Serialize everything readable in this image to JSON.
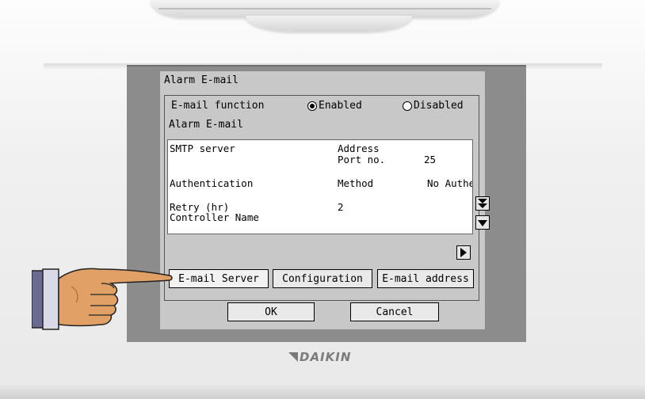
{
  "screen": {
    "title": "Alarm E-mail",
    "email_function": {
      "label": "E-mail function",
      "options": [
        "Enabled",
        "Disabled"
      ],
      "selected": "Enabled"
    },
    "section_label": "Alarm E-mail",
    "settings": {
      "smtp_server": "SMTP server",
      "address": "Address",
      "port_label": "Port no.",
      "port_value": "25",
      "authentication": "Authentication",
      "method_label": "Method",
      "method_value": "No Authe",
      "retry": "Retry (hr)",
      "retry_value": "2",
      "controller_name": "Controller Name"
    },
    "tabs": [
      "E-mail Server",
      "Configuration",
      "E-mail address"
    ],
    "active_tab": "E-mail Server",
    "ok": "OK",
    "cancel": "Cancel"
  },
  "brand": "DAIKIN",
  "icons": {
    "scroll_bottom": "double-down-arrow-icon",
    "scroll_down": "down-arrow-icon",
    "scroll_right": "right-arrow-icon",
    "pointing_hand": "pointing-hand-icon"
  }
}
